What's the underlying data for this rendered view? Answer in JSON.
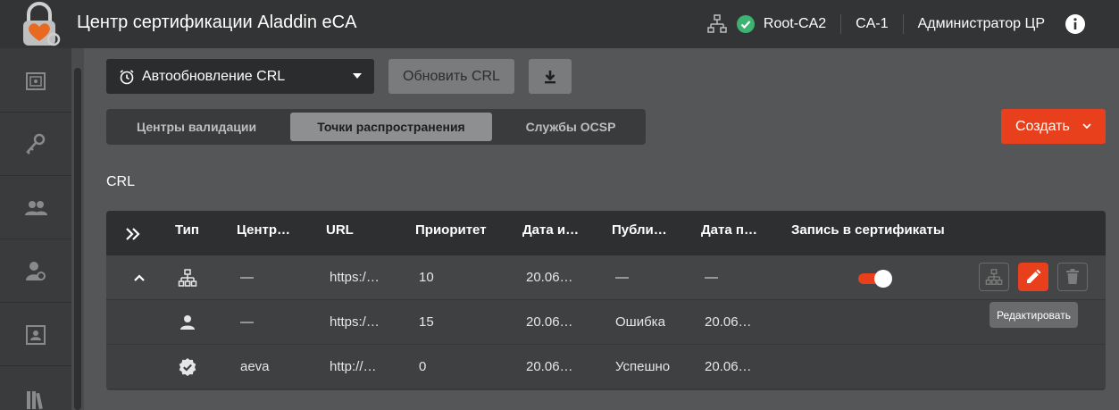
{
  "header": {
    "app_title": "Центр сертификации Aladdin eCA",
    "root_ca": "Root-CA2",
    "ca": "CA-1",
    "user": "Администратор ЦР",
    "icons": {
      "logo": "lock-heart-logo",
      "tree": "hierarchy-icon",
      "status": "check-circle-icon",
      "info": "info-icon"
    },
    "status_color": "#3cb371"
  },
  "sidebar": {
    "items": [
      {
        "icon": "safe-icon"
      },
      {
        "icon": "keys-icon"
      },
      {
        "icon": "users-icon"
      },
      {
        "icon": "user-cert-icon"
      },
      {
        "icon": "contact-card-icon"
      },
      {
        "icon": "library-icon"
      }
    ]
  },
  "toolbar": {
    "crl_select_value": "Автообновление CRL",
    "refresh_label": "Обновить CRL"
  },
  "tabs": [
    {
      "label": "Центры валидации",
      "active": false
    },
    {
      "label": "Точки распространения",
      "active": true
    },
    {
      "label": "Службы OCSP",
      "active": false
    }
  ],
  "create_label": "Создать",
  "section_label": "CRL",
  "table": {
    "columns": [
      "Тип",
      "Центр…",
      "URL",
      "Приоритет",
      "Дата и…",
      "Публи…",
      "Дата п…",
      "Запись в сертификаты"
    ],
    "rows": [
      {
        "type_icon": "hierarchy-icon",
        "center": "—",
        "url": "https:/…",
        "priority": "10",
        "date1": "20.06…",
        "publish": "—",
        "date2": "—",
        "write_to_certs": true
      },
      {
        "type_icon": "person-icon",
        "center": "—",
        "url": "https:/…",
        "priority": "15",
        "date1": "20.06…",
        "publish": "Ошибка",
        "date2": "20.06…"
      },
      {
        "type_icon": "verified-badge-icon",
        "center": "aeva",
        "url": "http://…",
        "priority": "0",
        "date1": "20.06…",
        "publish": "Успешно",
        "date2": "20.06…"
      }
    ]
  },
  "tooltip": "Редактировать",
  "colors": {
    "accent": "#e8401c",
    "header_bg": "#333435",
    "page_bg": "#555657"
  }
}
